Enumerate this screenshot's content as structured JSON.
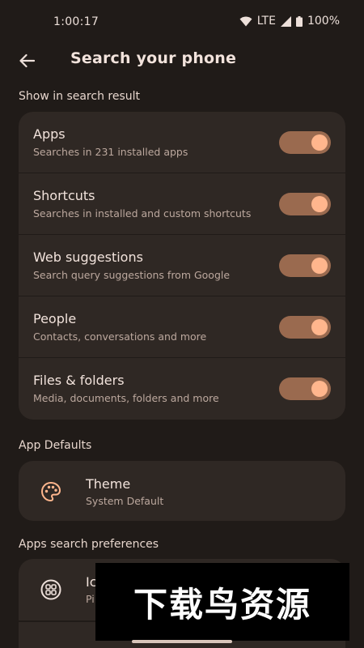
{
  "status_bar": {
    "time": "1:00:17",
    "network": "LTE",
    "battery": "100%"
  },
  "header": {
    "title": "Search your phone",
    "back_icon": "arrow-back-icon"
  },
  "sections": {
    "show_in_search": {
      "label": "Show in search result",
      "items": [
        {
          "title": "Apps",
          "subtitle": "Searches in 231 installed apps",
          "enabled": true
        },
        {
          "title": "Shortcuts",
          "subtitle": "Searches in installed and custom shortcuts",
          "enabled": true
        },
        {
          "title": "Web suggestions",
          "subtitle": "Search query suggestions from Google",
          "enabled": true
        },
        {
          "title": "People",
          "subtitle": "Contacts, conversations and more",
          "enabled": true
        },
        {
          "title": "Files & folders",
          "subtitle": "Media, documents, folders and more",
          "enabled": true
        }
      ]
    },
    "app_defaults": {
      "label": "App Defaults",
      "theme": {
        "title": "Theme",
        "subtitle": "System Default",
        "icon": "palette-icon"
      }
    },
    "apps_search_prefs": {
      "label": "Apps search preferences",
      "first_item": {
        "title": "Ic",
        "subtitle": "Pi",
        "icon": "icon-pack-icon"
      }
    }
  },
  "watermark": {
    "text": "下载鸟资源"
  },
  "colors": {
    "accent": "#ffb68d",
    "toggle_track": "#9a6a4f",
    "background": "#201b18",
    "card": "#2f2824"
  }
}
